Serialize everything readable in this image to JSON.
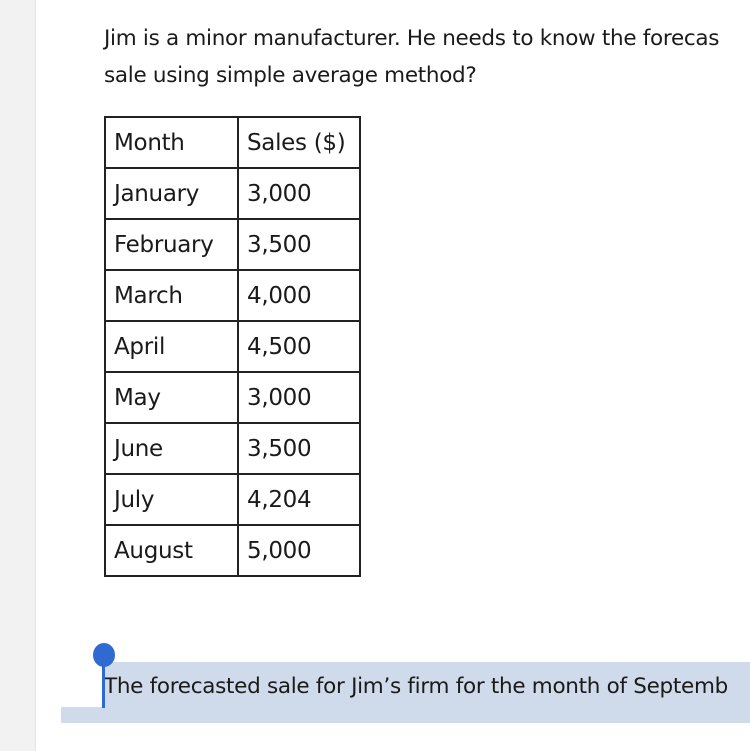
{
  "question": {
    "line1": "Jim is a minor manufacturer. He needs to know the forecas",
    "line2": "sale using simple average method?"
  },
  "table": {
    "headers": [
      "Month",
      "Sales ($)"
    ],
    "rows": [
      [
        "January",
        "3,000"
      ],
      [
        "February",
        "3,500"
      ],
      [
        "March",
        "4,000"
      ],
      [
        "April",
        "4,500"
      ],
      [
        "May",
        "3,000"
      ],
      [
        "June",
        "3,500"
      ],
      [
        "July",
        "4,204"
      ],
      [
        "August",
        "5,000"
      ]
    ]
  },
  "answer": {
    "text": "The forecasted sale for Jim’s firm for the month of Septemb",
    "highlight_color": "#cfdbea",
    "caret_color": "#2f6ad1"
  }
}
